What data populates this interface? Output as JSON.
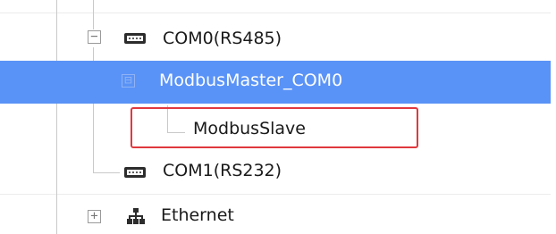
{
  "tree": {
    "nodes": [
      {
        "label": "COM0(RS485)",
        "expander": "−",
        "icon": "serial-port-icon"
      },
      {
        "label": "ModbusMaster_COM0",
        "expander": "⊟",
        "selected": true
      },
      {
        "label": "ModbusSlave",
        "highlighted": true
      },
      {
        "label": "COM1(RS232)",
        "icon": "serial-port-icon"
      },
      {
        "label": "Ethernet",
        "expander": "+",
        "icon": "network-icon"
      }
    ]
  },
  "colors": {
    "selection": "#5a93f7",
    "highlight_box": "#e0393e"
  }
}
